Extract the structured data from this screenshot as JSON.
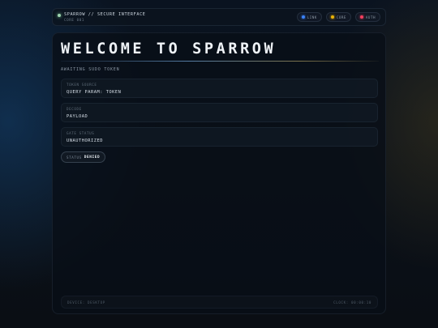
{
  "header": {
    "title": "SPARROW // SECURE INTERFACE",
    "subtitle": "CORE 001",
    "pills": [
      {
        "label": "LINK",
        "color": "#3b82f6"
      },
      {
        "label": "CORE",
        "color": "#eab308"
      },
      {
        "label": "AUTH",
        "color": "#f43f5e"
      }
    ]
  },
  "main": {
    "title": "WELCOME TO SPARROW",
    "subtitle": "AWAITING SUDO TOKEN",
    "fields": [
      {
        "label": "TOKEN SOURCE",
        "value": "QUERY PARAM: TOKEN"
      },
      {
        "label": "DECODE",
        "value": "PAYLOAD"
      },
      {
        "label": "GATE STATUS",
        "value": "UNAUTHORIZED"
      }
    ],
    "status": {
      "label": "STATUS",
      "value": "DENIED"
    }
  },
  "footer": {
    "device": "DEVICE: DESKTOP",
    "clock": "CLOCK: 00:00:10"
  }
}
